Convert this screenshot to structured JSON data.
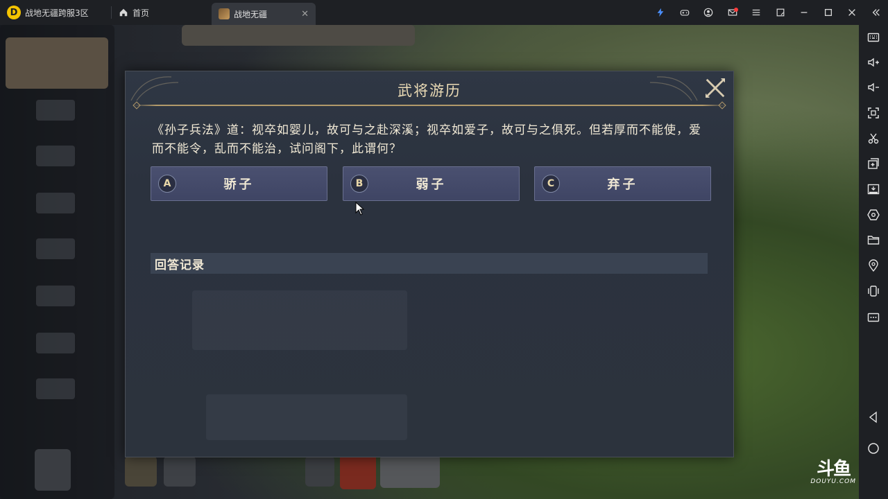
{
  "topbar": {
    "app_title": "战地无疆跨服3区",
    "home_tab": "首页",
    "game_tab": "战地无疆",
    "tab_close": "✕"
  },
  "dialog": {
    "title": "武将游历",
    "question": "《孙子兵法》道：视卒如婴儿，故可与之赴深溪；视卒如爱子，故可与之俱死。但若厚而不能使，爱而不能令，乱而不能治，试问阁下，此谓何？",
    "options": [
      {
        "letter": "A",
        "label": "骄子"
      },
      {
        "letter": "B",
        "label": "弱子"
      },
      {
        "letter": "C",
        "label": "弃子"
      }
    ],
    "record_title": "回答记录"
  },
  "watermark": {
    "logo": "斗鱼",
    "sub": "DOUYU.COM"
  },
  "icons": {
    "topbar": [
      "bolt-icon",
      "gamepad-icon",
      "user-icon",
      "mail-icon",
      "menu-icon",
      "restore-icon",
      "minimize-icon",
      "maximize-icon",
      "close-icon",
      "collapse-icon"
    ],
    "sidebar": [
      "keyboard-icon",
      "volume-up-icon",
      "volume-down-icon",
      "screenshot-icon",
      "scissors-icon",
      "add-window-icon",
      "apk-icon",
      "settings-hex-icon",
      "folder-icon",
      "location-icon",
      "shake-icon",
      "more-icon",
      "back-icon",
      "home-circle-icon"
    ]
  },
  "colors": {
    "accent_gold": "#b39a6a",
    "option_bg": "#4a5070",
    "bolt_blue": "#4a8df8",
    "mail_dot": "#ff3b3b"
  }
}
